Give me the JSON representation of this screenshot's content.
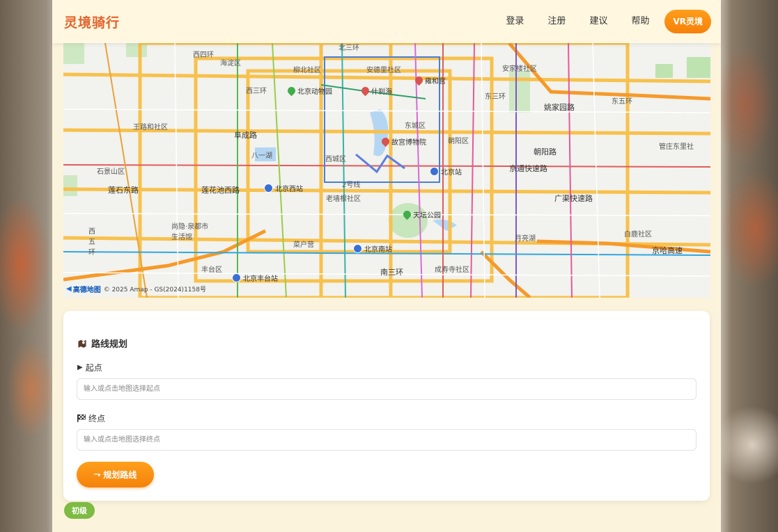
{
  "header": {
    "logo": "灵境骑行",
    "nav": {
      "login": "登录",
      "register": "注册",
      "suggest": "建议",
      "help": "帮助",
      "vr": "VR灵境"
    },
    "accent_color": "#f5810a",
    "logo_color": "#e2622a"
  },
  "map": {
    "labels": {
      "l1": "西四环",
      "l2": "海淀区",
      "l3": "柳北社区",
      "l4": "北三环",
      "l5": "安德里社区",
      "l6": "安家楼社区",
      "l7": "东三环",
      "l8": "东五环",
      "l9": "姚家园路",
      "l10": "西三环",
      "l11": "王路和社区",
      "l12": "阜成路",
      "l13": "东城区",
      "l14": "朝阳区",
      "l15": "朝阳路",
      "l16": "管庄东里社",
      "l17": "八一湖",
      "l18": "西城区",
      "l19": "石景山区",
      "l20": "京通快速路",
      "l21": "莲石东路",
      "l22": "莲花池西路",
      "l23": "2号线",
      "l24": "老墙根社区",
      "l25": "广渠快速路",
      "l26": "尚隐·泉都市生活馆",
      "l27": "南三环",
      "l28": "月亮湖",
      "l29": "白鹿社区",
      "l30": "京哈高速",
      "l31": "丰台区",
      "l32": "成寿寺社区",
      "l33": "西五环",
      "l34": "菜户营"
    },
    "pois": {
      "zoo": "北京动物园",
      "shichahai": "什刹海",
      "yonghegong": "雍和宫",
      "palace": "故宫博物院",
      "temple": "天坛公园",
      "bjz": "北京站",
      "bjw": "北京西站",
      "bjn": "北京南站",
      "bjf": "北京丰台站"
    },
    "credit": {
      "logo": "高德地图",
      "text": "© 2025 Amap - GS(2024)1158号"
    }
  },
  "route": {
    "title": "路线规划",
    "start_label": "起点",
    "start_placeholder": "输入或点击地图选择起点",
    "end_label": "终点",
    "end_placeholder": "输入或点击地图选择终点",
    "plan_button": "规划路线"
  },
  "level_badge": "初级"
}
